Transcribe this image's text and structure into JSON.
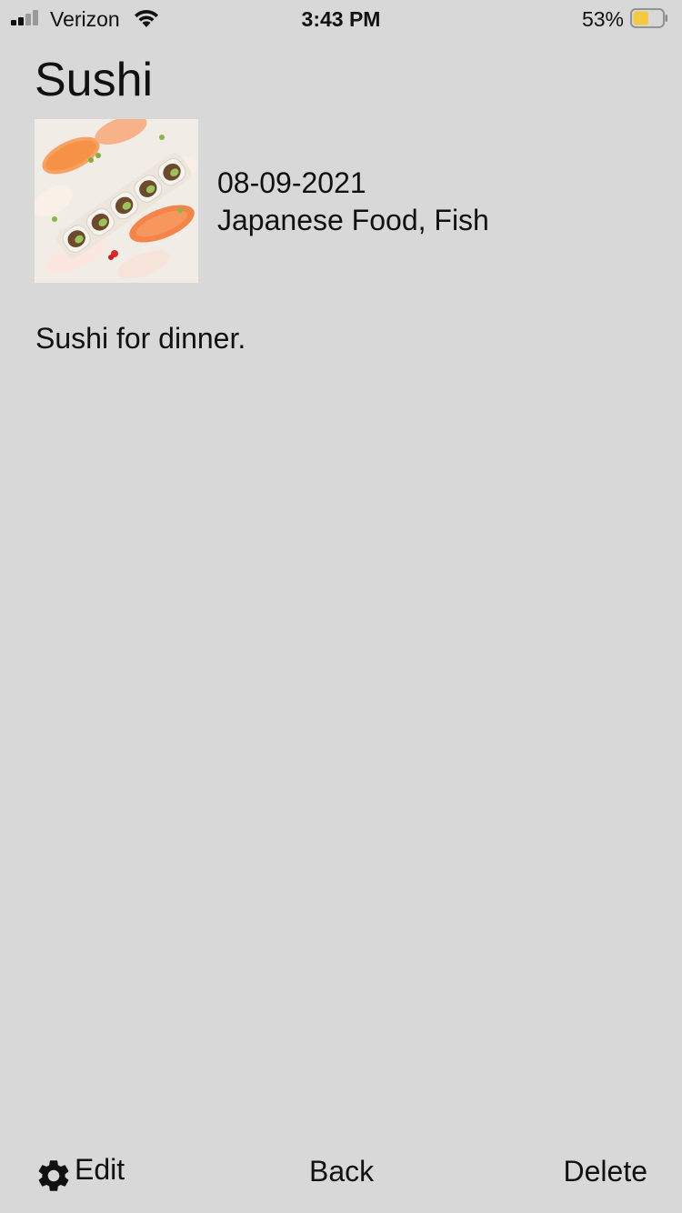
{
  "status_bar": {
    "carrier": "Verizon",
    "time": "3:43 PM",
    "battery_percent": "53%",
    "battery_level": 0.53,
    "signal_bars_active": 2,
    "signal_bars_total": 4,
    "battery_fill_color": "#f5c842"
  },
  "entry": {
    "title": "Sushi",
    "photo_icon": "sushi-photo",
    "date": "08-09-2021",
    "tags": "Japanese Food, Fish",
    "notes": "Sushi for dinner."
  },
  "toolbar": {
    "edit_icon": "gear-icon",
    "edit_label": "Edit",
    "back_label": "Back",
    "delete_label": "Delete"
  }
}
